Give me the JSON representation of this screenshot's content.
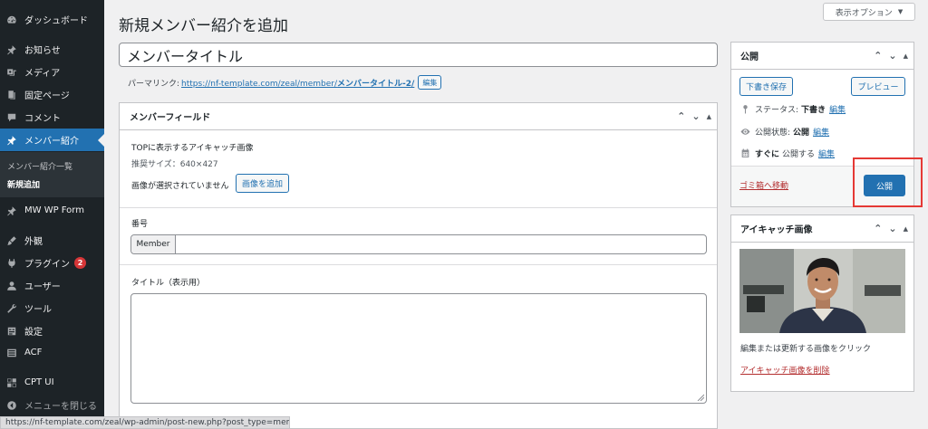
{
  "sidebar": {
    "items": [
      {
        "label": "ダッシュボード",
        "icon": "dashboard-icon"
      },
      {
        "label": "お知らせ",
        "icon": "pin-icon"
      },
      {
        "label": "メディア",
        "icon": "media-icon"
      },
      {
        "label": "固定ページ",
        "icon": "page-icon"
      },
      {
        "label": "コメント",
        "icon": "comment-icon"
      },
      {
        "label": "メンバー紹介",
        "icon": "pin-icon"
      },
      {
        "label": "MW WP Form",
        "icon": "pin-icon"
      },
      {
        "label": "外観",
        "icon": "brush-icon"
      },
      {
        "label": "プラグイン",
        "icon": "plugin-icon",
        "badge": "2"
      },
      {
        "label": "ユーザー",
        "icon": "user-icon"
      },
      {
        "label": "ツール",
        "icon": "wrench-icon"
      },
      {
        "label": "設定",
        "icon": "settings-icon"
      },
      {
        "label": "ACF",
        "icon": "acf-icon"
      },
      {
        "label": "CPT UI",
        "icon": "cpt-icon"
      },
      {
        "label": "メニューを閉じる",
        "icon": "collapse-icon"
      }
    ],
    "submenu": [
      {
        "label": "メンバー紹介一覧"
      },
      {
        "label": "新規追加"
      }
    ]
  },
  "header": {
    "title": "新規メンバー紹介を追加",
    "screen_options": "表示オプション"
  },
  "editor": {
    "title_value": "メンバータイトル",
    "permalink_label": "パーマリンク:",
    "permalink_base": "https://nf-template.com/zeal/member/",
    "permalink_slug": "メンバータイトル-2/",
    "permalink_edit": "編集"
  },
  "fields_box": {
    "title": "メンバーフィールド",
    "image_label": "TOPに表示するアイキャッチ画像",
    "image_size_note": "推奨サイズ：640×427",
    "no_image_text": "画像が選択されていません",
    "add_image_button": "画像を追加",
    "number_label": "番号",
    "number_prepend": "Member",
    "number_value": "",
    "title_label": "タイトル（表示用）",
    "title_value": ""
  },
  "publish_box": {
    "title": "公開",
    "save_draft": "下書き保存",
    "preview": "プレビュー",
    "status_label": "ステータス:",
    "status_value": "下書き",
    "visibility_label": "公開状態:",
    "visibility_value": "公開",
    "schedule_label": "すぐに",
    "schedule_value": "公開する",
    "edit_link": "編集",
    "trash_link": "ゴミ箱へ移動",
    "publish_button": "公開"
  },
  "featured_box": {
    "title": "アイキャッチ画像",
    "caption": "編集または更新する画像をクリック",
    "remove_link": "アイキャッチ画像を削除"
  },
  "status_bar": {
    "url": "https://nf-template.com/zeal/wp-admin/post-new.php?post_type=member#"
  },
  "colors": {
    "sidebar_bg": "#1d2327",
    "accent": "#2271b1",
    "danger": "#b32d2e",
    "highlight": "#e53935"
  }
}
